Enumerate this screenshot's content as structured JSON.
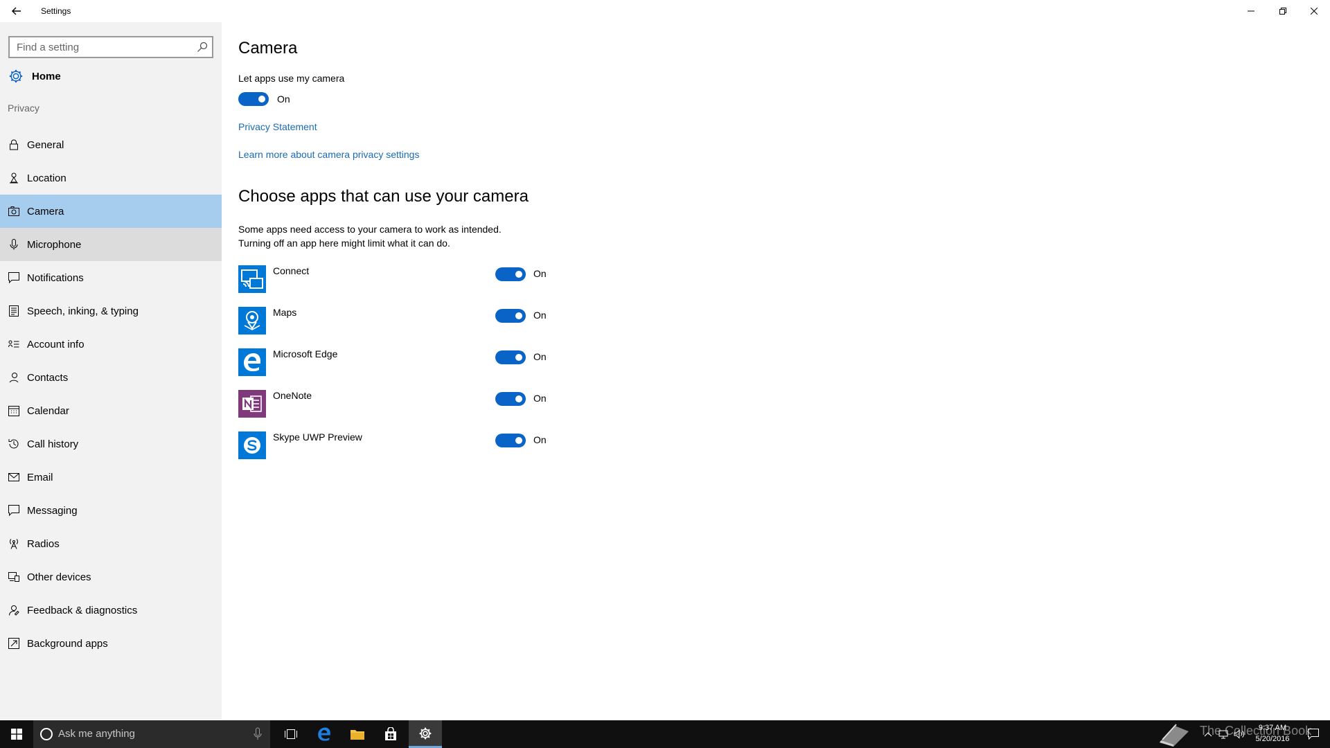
{
  "window": {
    "title": "Settings"
  },
  "sidebar": {
    "search_placeholder": "Find a setting",
    "home_label": "Home",
    "section_label": "Privacy",
    "items": [
      {
        "label": "General",
        "icon": "lock-icon"
      },
      {
        "label": "Location",
        "icon": "location-person-icon"
      },
      {
        "label": "Camera",
        "icon": "camera-icon",
        "selected": true
      },
      {
        "label": "Microphone",
        "icon": "microphone-icon",
        "hover": true
      },
      {
        "label": "Notifications",
        "icon": "notification-icon"
      },
      {
        "label": "Speech, inking, & typing",
        "icon": "speech-icon"
      },
      {
        "label": "Account info",
        "icon": "account-info-icon"
      },
      {
        "label": "Contacts",
        "icon": "contacts-icon"
      },
      {
        "label": "Calendar",
        "icon": "calendar-icon"
      },
      {
        "label": "Call history",
        "icon": "history-icon"
      },
      {
        "label": "Email",
        "icon": "mail-icon"
      },
      {
        "label": "Messaging",
        "icon": "message-icon"
      },
      {
        "label": "Radios",
        "icon": "radio-tower-icon"
      },
      {
        "label": "Other devices",
        "icon": "devices-icon"
      },
      {
        "label": "Feedback & diagnostics",
        "icon": "feedback-icon"
      },
      {
        "label": "Background apps",
        "icon": "background-apps-icon"
      }
    ]
  },
  "content": {
    "heading": "Camera",
    "master_toggle_label": "Let apps use my camera",
    "master_toggle_state": "On",
    "privacy_link": "Privacy Statement",
    "learn_more_link": "Learn more about camera privacy settings",
    "apps_heading": "Choose apps that can use your camera",
    "apps_desc_line1": "Some apps need access to your camera to work as intended.",
    "apps_desc_line2": "Turning off an app here might limit what it can do.",
    "apps": [
      {
        "name": "Connect",
        "state": "On",
        "icon": "connect-app-icon",
        "color": "#0078d7"
      },
      {
        "name": "Maps",
        "state": "On",
        "icon": "maps-app-icon",
        "color": "#0078d7"
      },
      {
        "name": "Microsoft Edge",
        "state": "On",
        "icon": "edge-app-icon",
        "color": "#0078d7"
      },
      {
        "name": "OneNote",
        "state": "On",
        "icon": "onenote-app-icon",
        "color": "#80397b"
      },
      {
        "name": "Skype UWP Preview",
        "state": "On",
        "icon": "skype-app-icon",
        "color": "#0078d7"
      }
    ]
  },
  "taskbar": {
    "search_placeholder": "Ask me anything",
    "clock_time": "9:37 AM",
    "clock_date": "5/20/2016"
  },
  "watermark": "The Collection Book",
  "colors": {
    "accent": "#0a64c8",
    "selected_nav": "#a7cdee",
    "link": "#1a6bb5"
  }
}
